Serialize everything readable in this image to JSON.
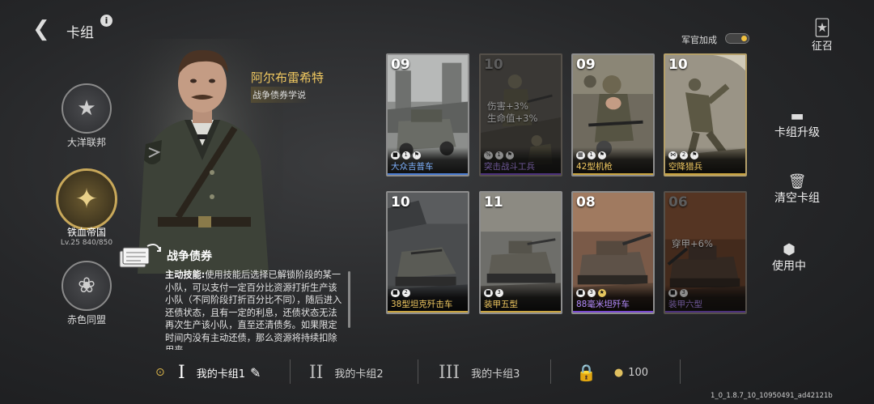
{
  "header": {
    "back_icon": "back-arrow-icon",
    "title": "卡组",
    "info": "i"
  },
  "factions": [
    {
      "id": "ocean",
      "name": "大洋联邦",
      "icon": "star-emblem-icon"
    },
    {
      "id": "iron",
      "name": "铁血帝国",
      "level": "Lv.25  840/850",
      "icon": "eagle-emblem-icon",
      "selected": true
    },
    {
      "id": "red",
      "name": "赤色同盟",
      "icon": "bear-emblem-icon"
    }
  ],
  "general": {
    "name": "阿尔布雷希特",
    "doctrine": "战争债券学说"
  },
  "skill": {
    "name": "战争债券",
    "label": "主动技能:",
    "text": "使用技能后选择已解锁阶段的某一小队，可以支付一定百分比资源打折生产该小队（不同阶段打折百分比不同），随后进入还债状态，且有一定的利息，还债状态无法再次生产该小队，直至还清债务。如果限定时间内没有主动还债，那么资源将持续扣除用来"
  },
  "officer": {
    "label": "军官加成",
    "enabled": true
  },
  "recruit": {
    "label": "征召",
    "icon": "cards-icon"
  },
  "menu": {
    "upgrade": {
      "label": "卡组升级",
      "icon": "tank-icon"
    },
    "clear": {
      "label": "清空卡组",
      "icon": "trash-icon"
    },
    "inuse": {
      "label": "使用中",
      "icon": "box-icon"
    }
  },
  "cards": [
    {
      "cost": "09",
      "name": "大众吉普车",
      "count": "1",
      "name_color": "blue",
      "type_icon": "vehicle-icon",
      "frame": "normal"
    },
    {
      "cost": "10",
      "name": "突击战斗工兵",
      "count": "1",
      "name_color": "purple",
      "type_icon": "infantry-icon",
      "frame": "dim",
      "bonus": [
        "伤害+3%",
        "生命值+3%"
      ]
    },
    {
      "cost": "09",
      "name": "42型机枪",
      "count": "1",
      "name_color": "gold",
      "type_icon": "mg-icon",
      "frame": "normal"
    },
    {
      "cost": "10",
      "name": "空降猎兵",
      "count": "2",
      "name_color": "gold",
      "type_icon": "paratrooper-icon",
      "frame": "gold"
    },
    {
      "cost": "10",
      "name": "38型坦克歼击车",
      "count": "2",
      "name_color": "gold",
      "type_icon": "vehicle-icon",
      "frame": "normal"
    },
    {
      "cost": "11",
      "name": "装甲五型",
      "count": "3",
      "name_color": "gold",
      "type_icon": "tank-icon",
      "frame": "normal"
    },
    {
      "cost": "08",
      "name": "88毫米坦歼车",
      "count": "3",
      "name_color": "purple",
      "type_icon": "tank-icon",
      "frame": "normal"
    },
    {
      "cost": "06",
      "name": "装甲六型",
      "count": "3",
      "name_color": "purple",
      "type_icon": "tank-icon",
      "frame": "dim",
      "bonus": [
        "穿甲+6%"
      ]
    }
  ],
  "decks": [
    {
      "numeral": "I",
      "label": "我的卡组1",
      "active": true
    },
    {
      "numeral": "II",
      "label": "我的卡组2"
    },
    {
      "numeral": "III",
      "label": "我的卡组3"
    }
  ],
  "lock": {
    "icon": "lock-icon",
    "coin_icon": "coin-icon",
    "price": "100"
  },
  "version": "1_0_1.8.7_10_10950491_ad42121b",
  "colors": {
    "gold": "#f0c860",
    "blue": "#7fb3ff",
    "purple": "#b58cff"
  }
}
